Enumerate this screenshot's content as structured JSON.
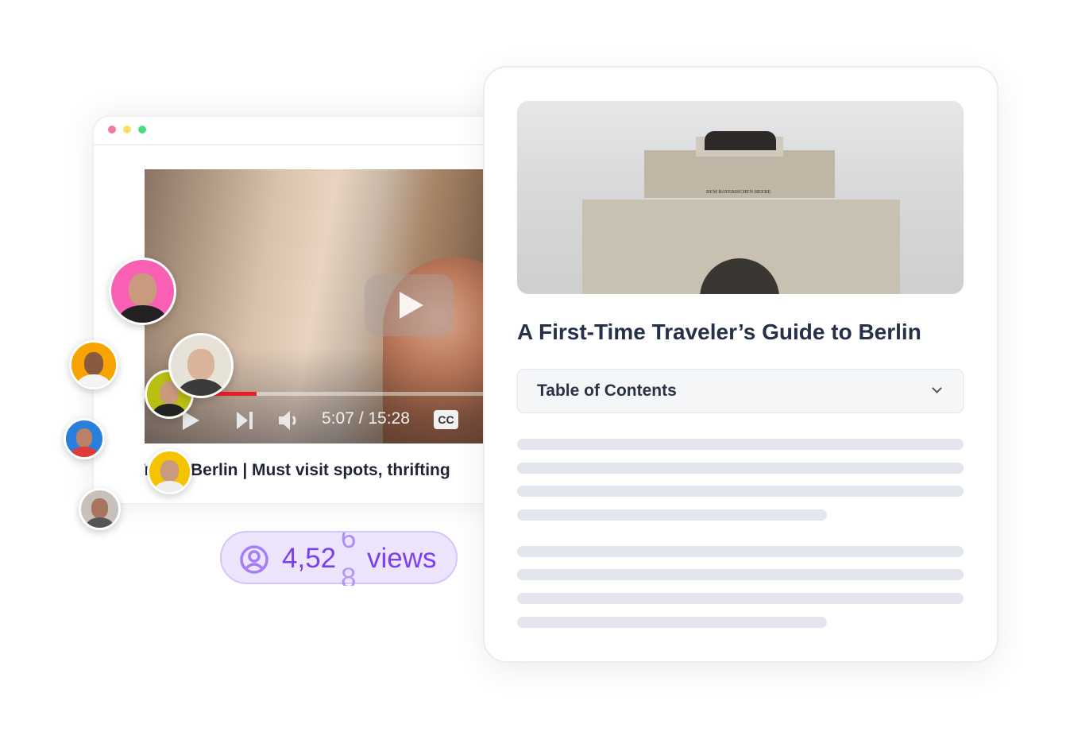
{
  "browser_window": {
    "dots": [
      "#f47a9b",
      "#fde068",
      "#4ade80"
    ]
  },
  "video": {
    "current_time": "5:07",
    "duration": "15:28",
    "time_display": "5:07 / 15:28",
    "progress_percent": 33,
    "cc_label": "CC",
    "progress_color": "#ee1c25",
    "title": "Trip to Berlin | Must visit spots, thrifting"
  },
  "viewers": {
    "avatar_colors": [
      "#f95fb3",
      "#f7a400",
      "#e6e2d8",
      "#b9be12",
      "#2a7fdc",
      "#f6c300",
      "#c8c0bb"
    ]
  },
  "views_badge": {
    "count": "4,52",
    "rolling_digit_top": "6",
    "rolling_digit_bottom": "8",
    "label": "views",
    "accent": "#7b3ff2"
  },
  "article": {
    "hero_inscription": "DEM BAYERISCHEN HEERE",
    "title": "A First-Time Traveler’s Guide to Berlin",
    "toc_label": "Table of Contents"
  }
}
